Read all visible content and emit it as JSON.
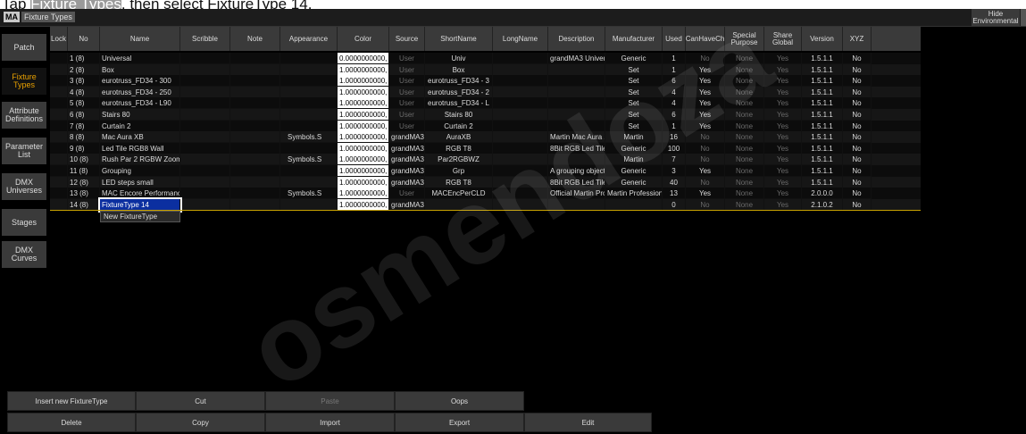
{
  "instruction": {
    "prefix": "Tap ",
    "highlight": "Fixture Types",
    "suffix": ", then select FixtureType 14."
  },
  "window": {
    "logo": "MA",
    "title": "Fixture Types",
    "hide_label": "Hide Environmental"
  },
  "sidebar": [
    {
      "label": "Patch",
      "active": false
    },
    {
      "label": "Fixture Types",
      "active": true
    },
    {
      "label": "Attribute Definitions",
      "active": false
    },
    {
      "label": "Parameter List",
      "active": false
    },
    {
      "label": "DMX Universes",
      "active": false
    },
    {
      "label": "Stages",
      "active": false
    },
    {
      "label": "DMX Curves",
      "active": false
    }
  ],
  "columns": [
    "Lock",
    "No",
    "Name",
    "Scribble",
    "Note",
    "Appearance",
    "Color",
    "Source",
    "ShortName",
    "LongName",
    "Description",
    "Manufacturer",
    "Used",
    "CanHaveCh",
    "Special Purpose",
    "Share Global",
    "Version",
    "XYZ"
  ],
  "rows": [
    {
      "no": "1 (8)",
      "name": "Universal",
      "appearance": "",
      "color": "0.0000000000,",
      "source": "User",
      "short": "Univ",
      "long": "",
      "desc": "grandMA3 Univers",
      "manu": "Generic",
      "used": "1",
      "canhave": "No",
      "special": "None",
      "share": "Yes",
      "version": "1.5.1.1",
      "xyz": "No"
    },
    {
      "no": "2 (8)",
      "name": "Box",
      "appearance": "",
      "color": "1.0000000000,",
      "source": "User",
      "short": "Box",
      "long": "",
      "desc": "",
      "manu": "Set",
      "used": "1",
      "canhave": "Yes",
      "special": "None",
      "share": "Yes",
      "version": "1.5.1.1",
      "xyz": "No"
    },
    {
      "no": "3 (8)",
      "name": "eurotruss_FD34 - 300",
      "appearance": "",
      "color": "1.0000000000,",
      "source": "User",
      "short": "eurotruss_FD34 - 3",
      "long": "",
      "desc": "",
      "manu": "Set",
      "used": "6",
      "canhave": "Yes",
      "special": "None",
      "share": "Yes",
      "version": "1.5.1.1",
      "xyz": "No"
    },
    {
      "no": "4 (8)",
      "name": "eurotruss_FD34 - 250",
      "appearance": "",
      "color": "1.0000000000,",
      "source": "User",
      "short": "eurotruss_FD34 - 2",
      "long": "",
      "desc": "",
      "manu": "Set",
      "used": "4",
      "canhave": "Yes",
      "special": "None",
      "share": "Yes",
      "version": "1.5.1.1",
      "xyz": "No"
    },
    {
      "no": "5 (8)",
      "name": "eurotruss_FD34 - L90",
      "appearance": "",
      "color": "1.0000000000,",
      "source": "User",
      "short": "eurotruss_FD34 - L",
      "long": "",
      "desc": "",
      "manu": "Set",
      "used": "4",
      "canhave": "Yes",
      "special": "None",
      "share": "Yes",
      "version": "1.5.1.1",
      "xyz": "No"
    },
    {
      "no": "6 (8)",
      "name": "Stairs 80",
      "appearance": "",
      "color": "1.0000000000,",
      "source": "User",
      "short": "Stairs 80",
      "long": "",
      "desc": "",
      "manu": "Set",
      "used": "6",
      "canhave": "Yes",
      "special": "None",
      "share": "Yes",
      "version": "1.5.1.1",
      "xyz": "No"
    },
    {
      "no": "7 (8)",
      "name": "Curtain 2",
      "appearance": "",
      "color": "1.0000000000,",
      "source": "User",
      "short": "Curtain 2",
      "long": "",
      "desc": "",
      "manu": "Set",
      "used": "1",
      "canhave": "Yes",
      "special": "None",
      "share": "Yes",
      "version": "1.5.1.1",
      "xyz": "No"
    },
    {
      "no": "8 (8)",
      "name": "Mac Aura XB",
      "appearance": "Symbols.S",
      "color": "1.0000000000,",
      "source": "grandMA3",
      "short": "AuraXB",
      "long": "",
      "desc": "Martin Mac Aura X",
      "manu": "Martin",
      "used": "16",
      "canhave": "No",
      "special": "None",
      "share": "Yes",
      "version": "1.5.1.1",
      "xyz": "No"
    },
    {
      "no": "9 (8)",
      "name": "Led Tile RGB8 Wall",
      "appearance": "",
      "color": "1.0000000000,",
      "source": "grandMA3",
      "short": "RGB T8",
      "long": "",
      "desc": "8Bit RGB Led Tile (",
      "manu": "Generic",
      "used": "100",
      "canhave": "No",
      "special": "None",
      "share": "Yes",
      "version": "1.5.1.1",
      "xyz": "No"
    },
    {
      "no": "10 (8)",
      "name": "Rush Par 2 RGBW Zoom",
      "appearance": "Symbols.S",
      "color": "1.0000000000,",
      "source": "grandMA3",
      "short": "Par2RGBWZ",
      "long": "",
      "desc": "",
      "manu": "Martin",
      "used": "7",
      "canhave": "No",
      "special": "None",
      "share": "Yes",
      "version": "1.5.1.1",
      "xyz": "No"
    },
    {
      "no": "11 (8)",
      "name": "Grouping",
      "appearance": "",
      "color": "1.0000000000,",
      "source": "grandMA3",
      "short": "Grp",
      "long": "",
      "desc": "A grouping object",
      "manu": "Generic",
      "used": "3",
      "canhave": "Yes",
      "special": "None",
      "share": "Yes",
      "version": "1.5.1.1",
      "xyz": "No"
    },
    {
      "no": "12 (8)",
      "name": "LED steps small",
      "appearance": "",
      "color": "1.0000000000,",
      "source": "grandMA3",
      "short": "RGB T8",
      "long": "",
      "desc": "8Bit RGB Led Tile (",
      "manu": "Generic",
      "used": "40",
      "canhave": "No",
      "special": "None",
      "share": "Yes",
      "version": "1.5.1.1",
      "xyz": "No"
    },
    {
      "no": "13 (8)",
      "name": "MAC Encore Performanc",
      "appearance": "Symbols.S",
      "color": "1.0000000000,",
      "source": "User",
      "short": "MACEncPerCLD",
      "long": "",
      "desc": "Official Martin Pro",
      "manu": "Martin Professiona",
      "used": "13",
      "canhave": "Yes",
      "special": "None",
      "share": "Yes",
      "version": "2.0.0.0",
      "xyz": "No"
    },
    {
      "no": "14 (8)",
      "name": "FixtureType 14",
      "appearance": "",
      "color": "1.0000000000,",
      "source": "grandMA3",
      "short": "",
      "long": "",
      "desc": "",
      "manu": "",
      "used": "0",
      "canhave": "No",
      "special": "None",
      "share": "Yes",
      "version": "2.1.0.2",
      "xyz": "No"
    }
  ],
  "new_row_label": "New FixtureType",
  "bottom": {
    "row1": [
      "Insert new FixtureType",
      "Cut",
      "Paste",
      "Oops"
    ],
    "row2": [
      "Delete",
      "Copy",
      "Import",
      "Export",
      "Edit"
    ]
  },
  "watermark": "osmendoza"
}
